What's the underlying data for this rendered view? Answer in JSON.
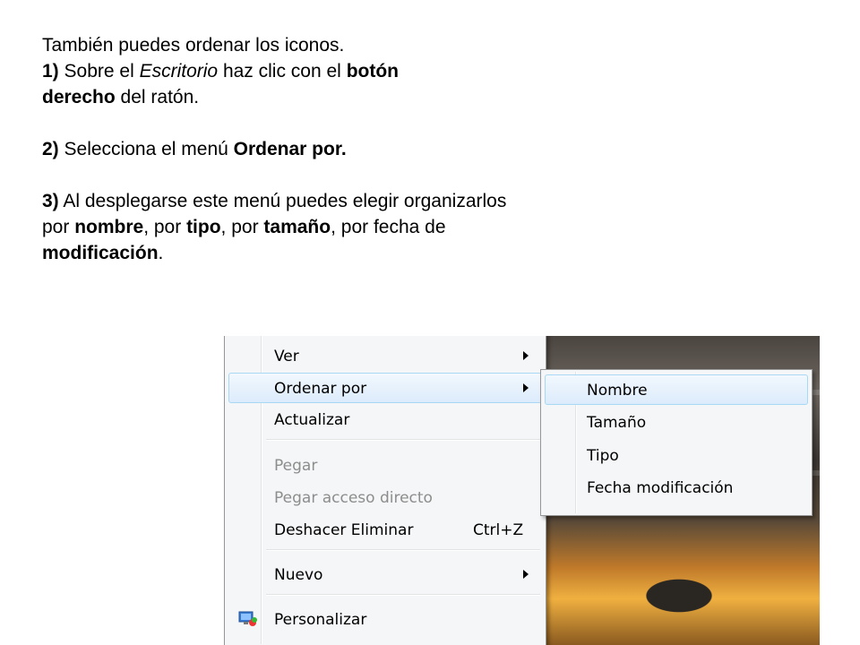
{
  "instructions": {
    "line1": "También puedes ordenar los iconos.",
    "step1": {
      "num": "1)",
      "t1": " Sobre el ",
      "escritorio": "Escritorio",
      "t2": " haz clic con el ",
      "boton": "botón",
      "derecho": "derecho",
      "t3": " del ratón."
    },
    "step2": {
      "num": "2)",
      "t1": " Selecciona el menú ",
      "ordenar": "Ordenar por."
    },
    "step3": {
      "num": "3)",
      "t1": " Al desplegarse este menú puedes elegir organizarlos por ",
      "nombre": "nombre",
      "t2": ", por ",
      "tipo": "tipo",
      "t3": ", por ",
      "tamano": "tamaño",
      "t4": ", por fecha de ",
      "modificacion": "modificación",
      "t5": "."
    }
  },
  "context_menu": {
    "items": {
      "ver": "Ver",
      "ordenar_por": "Ordenar por",
      "actualizar": "Actualizar",
      "pegar": "Pegar",
      "pegar_acceso": "Pegar acceso directo",
      "deshacer": "Deshacer Eliminar",
      "deshacer_shortcut": "Ctrl+Z",
      "nuevo": "Nuevo",
      "personalizar": "Personalizar"
    },
    "icons": {
      "personalizar": "personalize-icon"
    }
  },
  "submenu": {
    "items": {
      "nombre": "Nombre",
      "tamano": "Tamaño",
      "tipo": "Tipo",
      "fecha": "Fecha modificación"
    }
  },
  "colors": {
    "highlight_border": "#a8d8f3",
    "menu_bg": "#f5f6f7",
    "disabled_text": "#8d8d8d"
  }
}
